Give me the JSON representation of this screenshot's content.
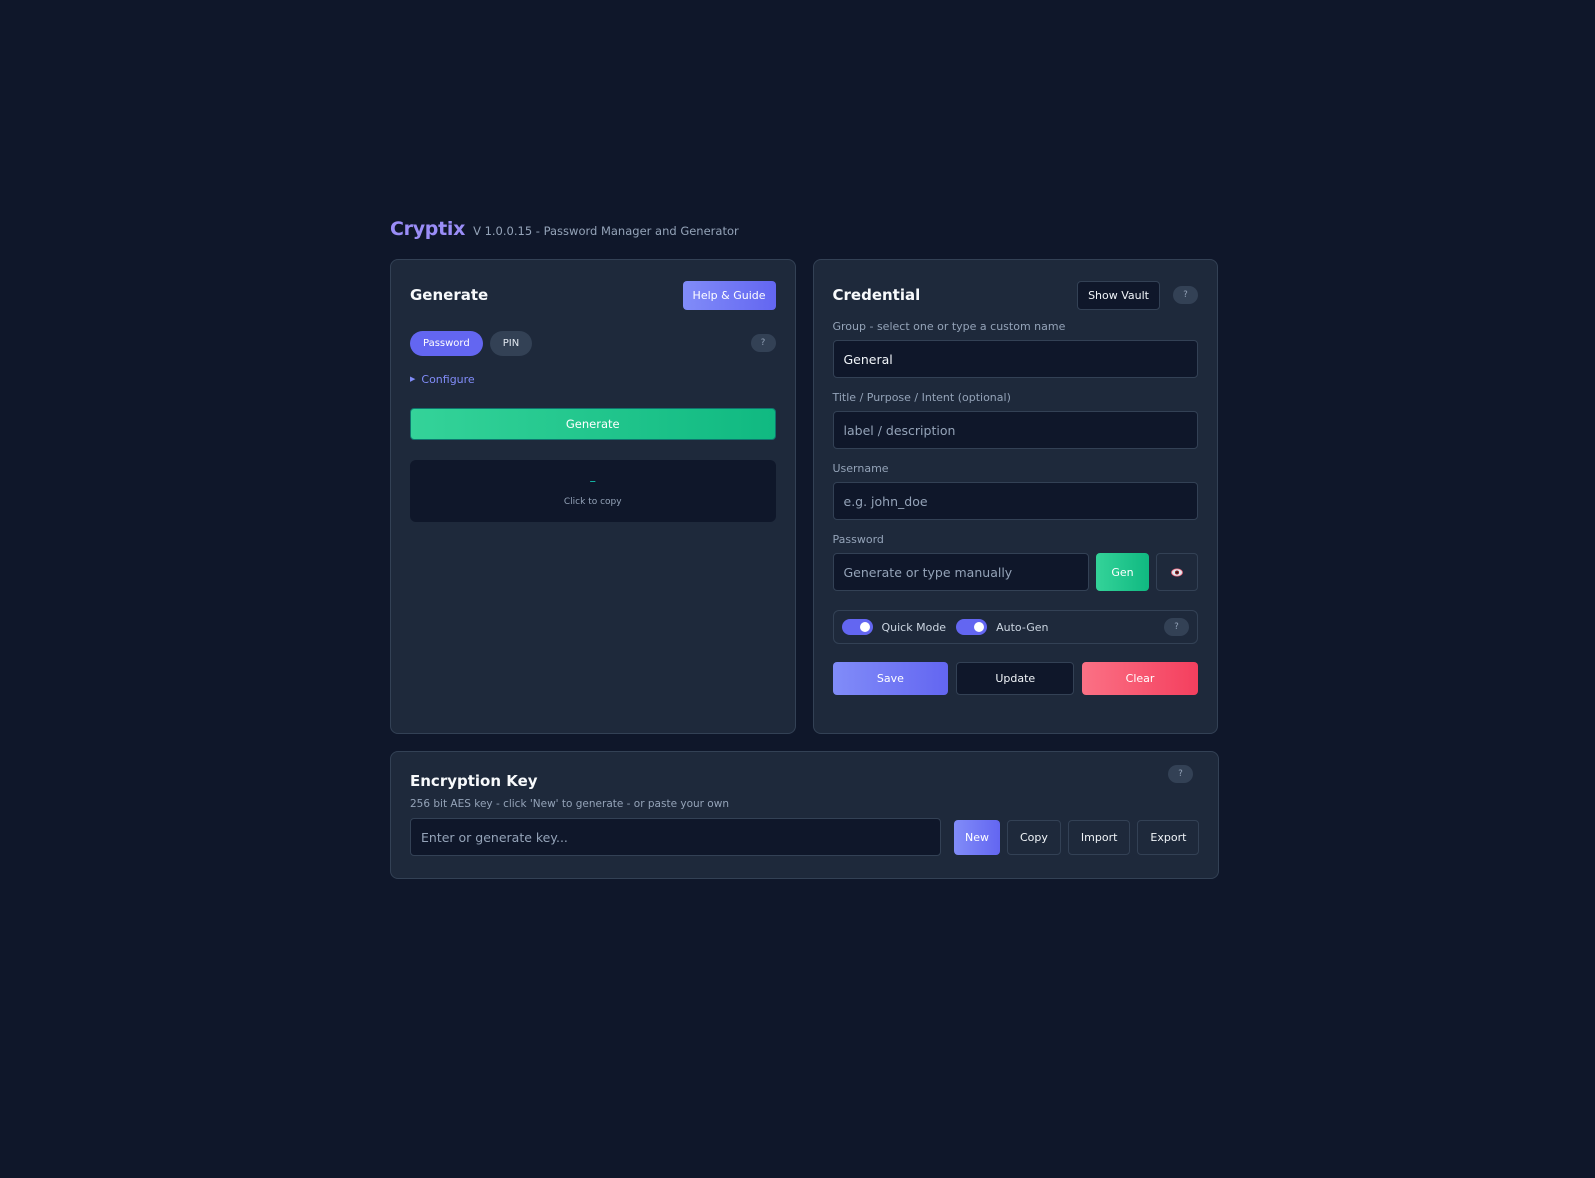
{
  "header": {
    "brand": "Cryptix",
    "subtitle": "V 1.0.0.15 - Password Manager and Generator"
  },
  "generate": {
    "title": "Generate",
    "help_button": "Help & Guide",
    "modes": [
      "Password",
      "PIN"
    ],
    "active_mode": "Password",
    "help": "?",
    "configure": "Configure",
    "generate_button": "Generate",
    "output_value": "–",
    "output_hint": "Click to copy"
  },
  "credential": {
    "title": "Credential",
    "show_vault": "Show Vault",
    "help": "?",
    "group_label": "Group - select one or type a custom name",
    "group_value": "General",
    "title_label": "Title / Purpose / Intent (optional)",
    "title_placeholder": "label / description",
    "username_label": "Username",
    "username_placeholder": "e.g. john_doe",
    "password_label": "Password",
    "password_placeholder": "Generate or type manually",
    "gen_button": "Gen",
    "quick_mode": "Quick Mode",
    "auto_gen": "Auto-Gen",
    "save": "Save",
    "update": "Update",
    "clear": "Clear"
  },
  "encryption": {
    "title": "Encryption Key",
    "description": "256 bit AES key - click 'New' to generate - or paste your own",
    "placeholder": "Enter or generate key...",
    "help": "?",
    "buttons": {
      "new": "New",
      "copy": "Copy",
      "import": "Import",
      "export": "Export"
    }
  },
  "colors": {
    "background": "#0f172a",
    "card": "#1e293b",
    "accent": "#6366f1",
    "success": "#10b981",
    "danger": "#f43f5e"
  }
}
